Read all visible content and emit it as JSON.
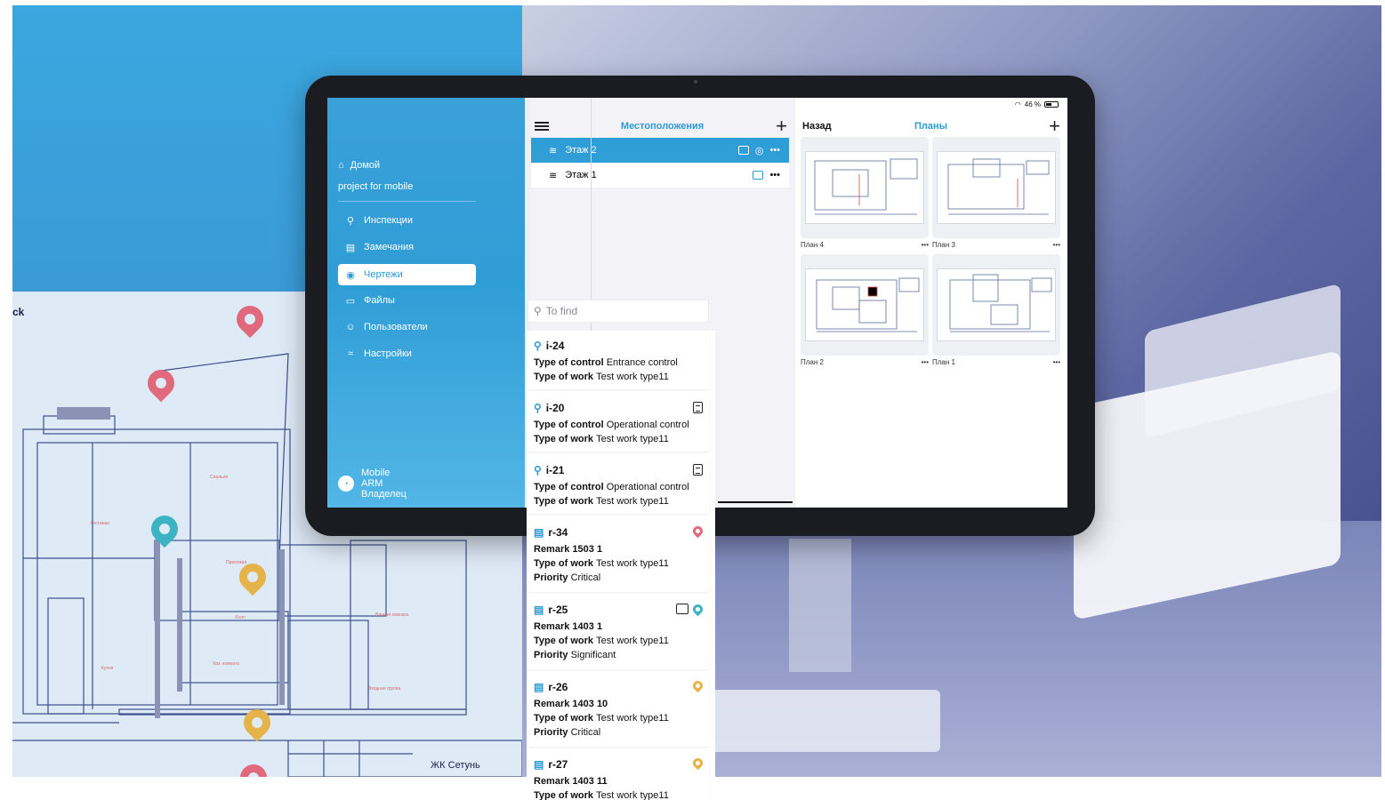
{
  "colors": {
    "brand": "#2a9bd6",
    "sidebar": "#2f9dd6",
    "pin_red": "#e0697e",
    "pin_teal": "#3cb4c2",
    "pin_yellow": "#e6b24a"
  },
  "floorplan": {
    "title": "ck",
    "footer": "ЖК Сетунь"
  },
  "sidebar": {
    "home_label": "Домой",
    "project": "project for mobile",
    "items": [
      {
        "label": "Инспекции",
        "icon": "search-icon"
      },
      {
        "label": "Замечания",
        "icon": "clipboard-icon"
      },
      {
        "label": "Чертежи",
        "icon": "pin-icon",
        "active": true
      },
      {
        "label": "Файлы",
        "icon": "folder-icon"
      },
      {
        "label": "Пользователи",
        "icon": "users-icon"
      },
      {
        "label": "Настройки",
        "icon": "settings-icon"
      }
    ],
    "user": {
      "line1": "Mobile",
      "line2": "ARM",
      "line3": "Владелец"
    }
  },
  "locations": {
    "title": "Местоположения",
    "floors": [
      {
        "label": "Этаж 2",
        "selected": true
      },
      {
        "label": "Этаж 1",
        "selected": false
      }
    ]
  },
  "plans": {
    "status": "46 %",
    "back": "Назад",
    "title": "Планы",
    "items": [
      {
        "label": "План 4",
        "more": "•••"
      },
      {
        "label": "План 3",
        "more": "•••"
      },
      {
        "label": "План 2",
        "more": "•••"
      },
      {
        "label": "План 1",
        "more": "•••"
      }
    ]
  },
  "search": {
    "placeholder": "To find"
  },
  "cards": [
    {
      "id": "i-24",
      "kind": "inspection",
      "control_label": "Type of control",
      "control": "Entrance control",
      "work_label": "Type of work",
      "work": "Test work type11"
    },
    {
      "id": "i-20",
      "kind": "inspection",
      "control_label": "Type of control",
      "control": "Operational control",
      "work_label": "Type of work",
      "work": "Test work type11"
    },
    {
      "id": "i-21",
      "kind": "inspection",
      "control_label": "Type of control",
      "control": "Operational control",
      "work_label": "Type of work",
      "work": "Test work type11"
    },
    {
      "id": "r-34",
      "kind": "remark",
      "title": "Remark 1503 1",
      "work_label": "Type of work",
      "work": "Test work type11",
      "priority_label": "Priority",
      "priority": "Critical"
    },
    {
      "id": "r-25",
      "kind": "remark",
      "title": "Remark 1403 1",
      "work_label": "Type of work",
      "work": "Test work type11",
      "priority_label": "Priority",
      "priority": "Significant"
    },
    {
      "id": "r-26",
      "kind": "remark",
      "title": "Remark 1403 10",
      "work_label": "Type of work",
      "work": "Test work type11",
      "priority_label": "Priority",
      "priority": "Critical"
    },
    {
      "id": "r-27",
      "kind": "remark",
      "title": "Remark 1403 11",
      "work_label": "Type of work",
      "work": "Test work type11"
    }
  ]
}
